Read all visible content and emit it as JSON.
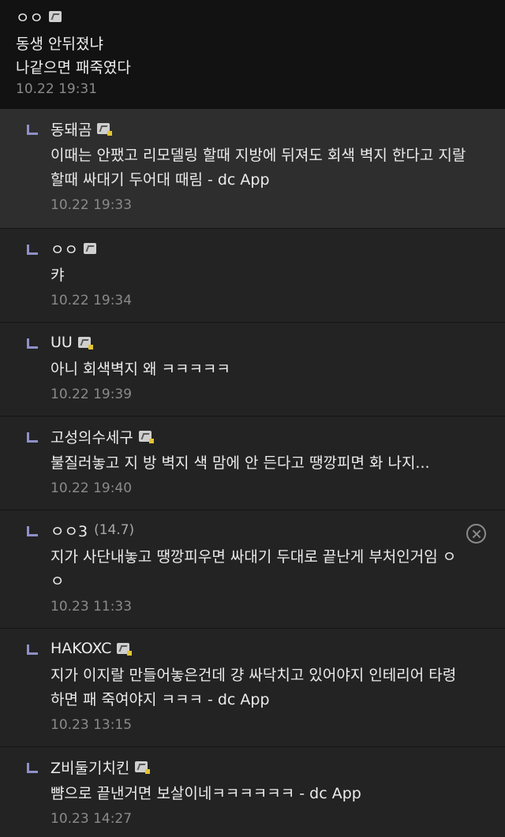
{
  "top_comment": {
    "nick": "ㅇㅇ",
    "lines": [
      "동생 안뒤졌냐",
      "나같으면 패죽였다"
    ],
    "time": "10.22 19:31"
  },
  "replies": [
    {
      "nick": "동돼곰",
      "lines": [
        "이때는 안팼고 리모델링 할때 지방에 뒤져도 회색 벽지 한다고 지랄",
        "할때 싸대기 두어대 때림 - dc App"
      ],
      "time": "10.22 19:33"
    },
    {
      "nick": "ㅇㅇ",
      "lines": [
        "캬"
      ],
      "time": "10.22 19:34"
    },
    {
      "nick": "UU",
      "lines": [
        "아니 회색벽지 왜 ㅋㅋㅋㅋㅋ"
      ],
      "time": "10.22 19:39"
    },
    {
      "nick": "고성의수세구",
      "lines": [
        "불질러놓고 지 방 벽지 색 맘에 안 든다고 땡깡피면 화 나지..."
      ],
      "time": "10.22 19:40"
    },
    {
      "nick": "ㅇㅇ3",
      "ip": "(14.7)",
      "lines": [
        "지가 사단내놓고 땡깡피우면 싸대기 두대로 끝난게 부처인거임 ㅇ",
        "ㅇ"
      ],
      "time": "10.23 11:33"
    },
    {
      "nick": "HAKOXC",
      "lines": [
        "지가 이지랄 만들어놓은건데 걍 싸닥치고 있어야지 인테리어 타령",
        "하면 패 죽여야지 ㅋㅋㅋ - dc App"
      ],
      "time": "10.23 13:15"
    },
    {
      "nick": "Z비둘기치킨",
      "lines": [
        "뺨으로 끝낸거면 보살이네ㅋㅋㅋㅋㅋㅋ - dc App"
      ],
      "time": "10.23 14:27"
    }
  ],
  "icons": {
    "reply_arrow": "reply-arrow-icon",
    "gallog": "gallog-icon",
    "fixed_gallog": "fixed-gallog-icon",
    "delete": "close-circle-icon"
  },
  "colors": {
    "top_background": "#121212",
    "background": "#232323",
    "highlight_background": "#2e2e2e",
    "reply_arrow": "#8f90c8",
    "time_text": "#8a8a8a",
    "gold_badge": "#e3c533"
  }
}
